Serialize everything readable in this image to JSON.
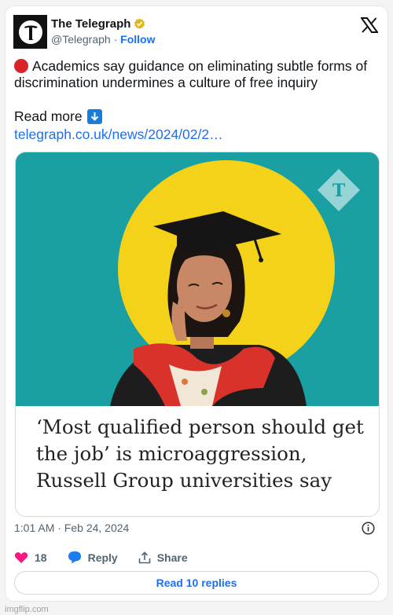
{
  "account": {
    "name": "The Telegraph",
    "handle": "@Telegraph",
    "separator": "·",
    "follow_label": "Follow"
  },
  "tweet": {
    "text": "Academics say guidance on eliminating subtle forms of discrimination undermines a culture of free inquiry",
    "read_more": "Read more",
    "link": "telegraph.co.uk/news/2024/02/2…"
  },
  "card": {
    "headline": "‘Most qualified person should get the job’ is microaggression, Russell Group universities say"
  },
  "meta": {
    "timestamp": "1:01 AM · Feb 24, 2024"
  },
  "actions": {
    "like_count": "18",
    "reply_label": "Reply",
    "share_label": "Share"
  },
  "footer": {
    "read_replies": "Read 10 replies"
  },
  "watermark": "imgflip.com",
  "colors": {
    "link": "#1d6ff0",
    "like": "#f91880",
    "accent_teal": "#1a9fa2",
    "accent_yellow": "#f4d21a"
  }
}
